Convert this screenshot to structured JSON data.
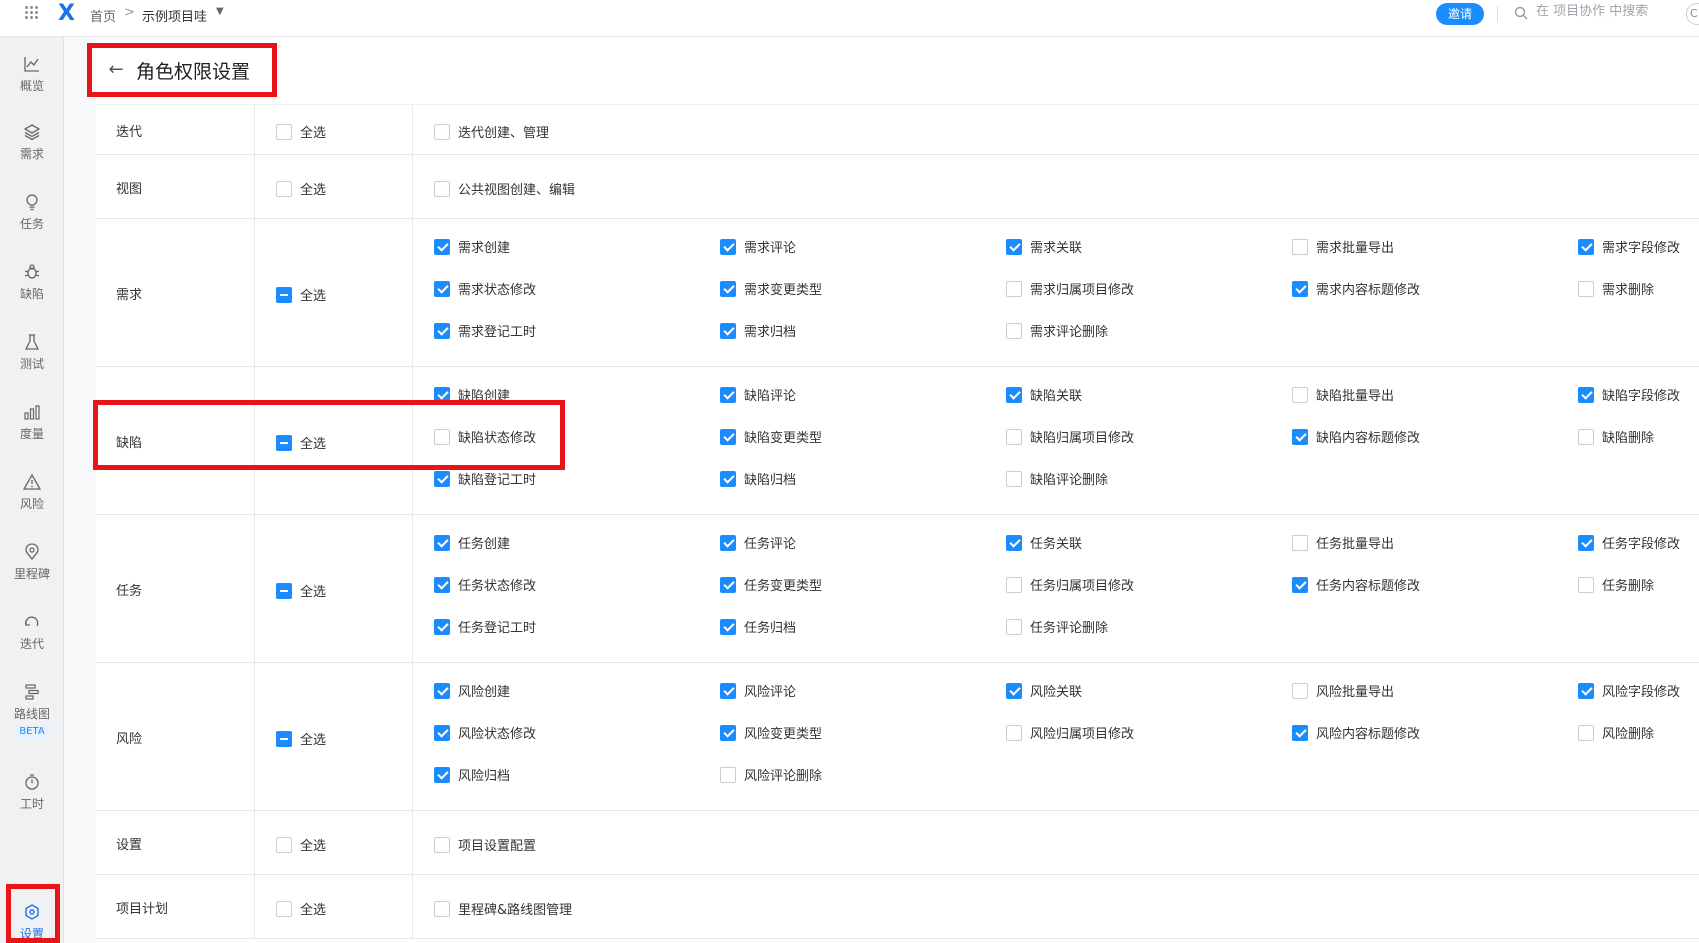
{
  "topbar": {
    "logo": "X",
    "breadcrumb_home": "首页",
    "breadcrumb_sep": ">",
    "project_name": "示例项目哇",
    "invite_label": "邀请",
    "search_placeholder": "在 项目协作 中搜索",
    "avatar_text": "C"
  },
  "nav": {
    "items": [
      {
        "label": "概览",
        "icon": "chart-line-icon"
      },
      {
        "label": "需求",
        "icon": "layers-icon"
      },
      {
        "label": "任务",
        "icon": "lightbulb-icon"
      },
      {
        "label": "缺陷",
        "icon": "bug-icon"
      },
      {
        "label": "测试",
        "icon": "flask-icon"
      },
      {
        "label": "度量",
        "icon": "bar-chart-icon"
      },
      {
        "label": "风险",
        "icon": "warning-icon"
      },
      {
        "label": "里程碑",
        "icon": "map-pin-icon"
      },
      {
        "label": "迭代",
        "icon": "cycle-icon"
      },
      {
        "label": "路线图",
        "icon": "roadmap-icon"
      },
      {
        "label": "工时",
        "icon": "stopwatch-icon"
      },
      {
        "label": "设置",
        "icon": "settings-hex-icon"
      }
    ],
    "beta": "BETA"
  },
  "page": {
    "title": "角色权限设置",
    "back": "←"
  },
  "select_all": "全选",
  "rows": [
    {
      "label": "迭代",
      "state": "off",
      "perms": [
        {
          "label": "迭代创建、管理",
          "on": false
        }
      ]
    },
    {
      "label": "视图",
      "state": "off",
      "perms": [
        {
          "label": "公共视图创建、编辑",
          "on": false
        }
      ]
    },
    {
      "label": "需求",
      "state": "partial",
      "perms": [
        {
          "label": "需求创建",
          "on": true
        },
        {
          "label": "需求评论",
          "on": true
        },
        {
          "label": "需求关联",
          "on": true
        },
        {
          "label": "需求批量导出",
          "on": false
        },
        {
          "label": "需求字段修改",
          "on": true
        },
        {
          "label": "需求状态修改",
          "on": true
        },
        {
          "label": "需求变更类型",
          "on": true
        },
        {
          "label": "需求归属项目修改",
          "on": false
        },
        {
          "label": "需求内容标题修改",
          "on": true
        },
        {
          "label": "需求删除",
          "on": false
        },
        {
          "label": "需求登记工时",
          "on": true
        },
        {
          "label": "需求归档",
          "on": true
        },
        {
          "label": "需求评论删除",
          "on": false
        }
      ]
    },
    {
      "label": "缺陷",
      "state": "partial",
      "perms": [
        {
          "label": "缺陷创建",
          "on": true
        },
        {
          "label": "缺陷评论",
          "on": true
        },
        {
          "label": "缺陷关联",
          "on": true
        },
        {
          "label": "缺陷批量导出",
          "on": false
        },
        {
          "label": "缺陷字段修改",
          "on": true
        },
        {
          "label": "缺陷状态修改",
          "on": false
        },
        {
          "label": "缺陷变更类型",
          "on": true
        },
        {
          "label": "缺陷归属项目修改",
          "on": false
        },
        {
          "label": "缺陷内容标题修改",
          "on": true
        },
        {
          "label": "缺陷删除",
          "on": false
        },
        {
          "label": "缺陷登记工时",
          "on": true
        },
        {
          "label": "缺陷归档",
          "on": true
        },
        {
          "label": "缺陷评论删除",
          "on": false
        }
      ]
    },
    {
      "label": "任务",
      "state": "partial",
      "perms": [
        {
          "label": "任务创建",
          "on": true
        },
        {
          "label": "任务评论",
          "on": true
        },
        {
          "label": "任务关联",
          "on": true
        },
        {
          "label": "任务批量导出",
          "on": false
        },
        {
          "label": "任务字段修改",
          "on": true
        },
        {
          "label": "任务状态修改",
          "on": true
        },
        {
          "label": "任务变更类型",
          "on": true
        },
        {
          "label": "任务归属项目修改",
          "on": false
        },
        {
          "label": "任务内容标题修改",
          "on": true
        },
        {
          "label": "任务删除",
          "on": false
        },
        {
          "label": "任务登记工时",
          "on": true
        },
        {
          "label": "任务归档",
          "on": true
        },
        {
          "label": "任务评论删除",
          "on": false
        }
      ]
    },
    {
      "label": "风险",
      "state": "partial",
      "perms": [
        {
          "label": "风险创建",
          "on": true
        },
        {
          "label": "风险评论",
          "on": true
        },
        {
          "label": "风险关联",
          "on": true
        },
        {
          "label": "风险批量导出",
          "on": false
        },
        {
          "label": "风险字段修改",
          "on": true
        },
        {
          "label": "风险状态修改",
          "on": true
        },
        {
          "label": "风险变更类型",
          "on": true
        },
        {
          "label": "风险归属项目修改",
          "on": false
        },
        {
          "label": "风险内容标题修改",
          "on": true
        },
        {
          "label": "风险删除",
          "on": false
        },
        {
          "label": "风险归档",
          "on": true
        },
        {
          "label": "风险评论删除",
          "on": false
        }
      ]
    },
    {
      "label": "设置",
      "state": "off",
      "perms": [
        {
          "label": "项目设置配置",
          "on": false
        }
      ]
    },
    {
      "label": "项目计划",
      "state": "off",
      "perms": [
        {
          "label": "里程碑&路线图管理",
          "on": false
        }
      ]
    }
  ]
}
